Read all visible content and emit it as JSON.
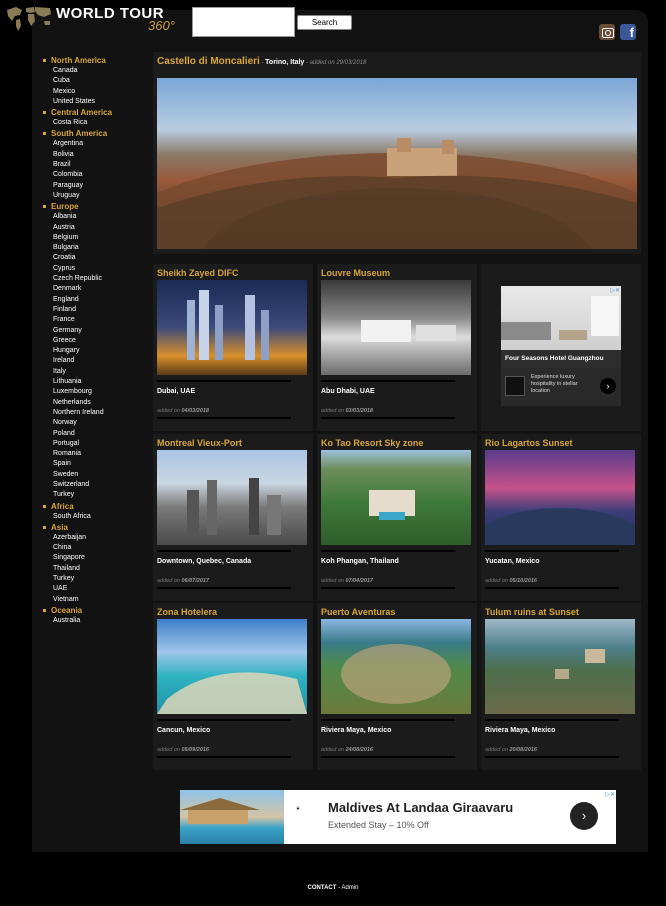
{
  "header": {
    "logo_title": "WORLD TOUR",
    "logo_sub": "360°",
    "search_placeholder": "",
    "search_button": "Search"
  },
  "sidebar": [
    {
      "region": "North America",
      "countries": [
        "Canada",
        "Cuba",
        "Mexico",
        "United States"
      ]
    },
    {
      "region": "Central America",
      "countries": [
        "Costa Rica"
      ]
    },
    {
      "region": "South America",
      "countries": [
        "Argentina",
        "Bolivia",
        "Brazil",
        "Colombia",
        "Paraguay",
        "Uruguay"
      ]
    },
    {
      "region": "Europe",
      "countries": [
        "Albania",
        "Austria",
        "Belgium",
        "Bulgaria",
        "Croatia",
        "Cyprus",
        "Czech Republic",
        "Denmark",
        "England",
        "Finland",
        "France",
        "Germany",
        "Greece",
        "Hungary",
        "Ireland",
        "Italy",
        "Lithuania",
        "Luxembourg",
        "Netherlands",
        "Northern Ireland",
        "Norway",
        "Poland",
        "Portugal",
        "Romania",
        "Spain",
        "Sweden",
        "Switzerland",
        "Turkey"
      ]
    },
    {
      "region": "Africa",
      "countries": [
        "South Africa"
      ]
    },
    {
      "region": "Asia",
      "countries": [
        "Azerbaijan",
        "China",
        "Singapore",
        "Thailand",
        "Turkey",
        "UAE",
        "Vietnam"
      ]
    },
    {
      "region": "Oceania",
      "countries": [
        "Australia"
      ]
    }
  ],
  "featured": {
    "title": "Castello di Moncalieri",
    "sep": " - ",
    "location": "Torino, Italy",
    "added_prefix": " - added on ",
    "date": "29/03/2018"
  },
  "cards": [
    {
      "title": "Sheikh Zayed DIFC",
      "location": "Dubai, UAE",
      "date": "04/03/2018"
    },
    {
      "title": "Louvre Museum",
      "location": "Abu Dhabi, UAE",
      "date": "03/03/2018"
    },
    {
      "title": "Montreal Vieux-Port",
      "location": "Downtown, Quebec, Canada",
      "date": "06/07/2017"
    },
    {
      "title": "Ko Tao Resort Sky zone",
      "location": "Koh Phangan, Thailand",
      "date": "07/04/2017"
    },
    {
      "title": "Rio Lagartos Sunset",
      "location": "Yucatan, Mexico",
      "date": "05/10/2016"
    },
    {
      "title": "Zona Hotelera",
      "location": "Cancun, Mexico",
      "date": "05/09/2016"
    },
    {
      "title": "Puerto Aventuras",
      "location": "Riviera Maya, Mexico",
      "date": "24/08/2016"
    },
    {
      "title": "Tulum ruins at Sunset",
      "location": "Riviera Maya, Mexico",
      "date": "20/08/2016"
    }
  ],
  "added_label": "added on ",
  "ad_side": {
    "headline": "Four Seasons Hotel Guangzhou",
    "body": "Experience luxury hospitality in stellar location"
  },
  "ad_banner": {
    "headline": "Maldives At Landaa Giraavaru",
    "sub": "Extended Stay – 10% Off"
  },
  "footer": {
    "contact": "CONTACT",
    "sep": " - ",
    "admin": "Admin"
  }
}
